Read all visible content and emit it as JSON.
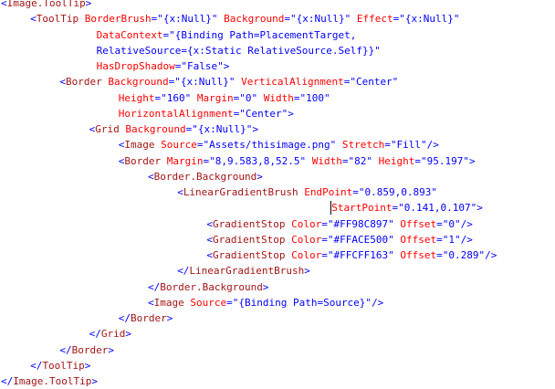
{
  "colors": {
    "punct": "#0000ff",
    "element": "#a31515",
    "attribute": "#ff0000",
    "value": "#0000ff",
    "background": "#ffffff"
  },
  "lines": [
    {
      "indent": 0,
      "tokens": [
        {
          "t": "<",
          "k": "punct"
        },
        {
          "t": "Image.ToolTip",
          "k": "element"
        },
        {
          "t": ">",
          "k": "punct"
        }
      ]
    },
    {
      "indent": 4,
      "tokens": [
        {
          "t": "<",
          "k": "punct"
        },
        {
          "t": "ToolTip",
          "k": "element"
        },
        {
          "t": " BorderBrush",
          "k": "attribute"
        },
        {
          "t": "=\"{x:Null}\"",
          "k": "value"
        },
        {
          "t": " Background",
          "k": "attribute"
        },
        {
          "t": "=\"{x:Null}\"",
          "k": "value"
        },
        {
          "t": " Effect",
          "k": "attribute"
        },
        {
          "t": "=\"{x:Null}\"",
          "k": "value"
        }
      ]
    },
    {
      "indent": 13,
      "tokens": [
        {
          "t": "DataContext",
          "k": "attribute"
        },
        {
          "t": "=\"{Binding Path=PlacementTarget,",
          "k": "value"
        }
      ]
    },
    {
      "indent": 13,
      "tokens": [
        {
          "t": "RelativeSource={x:Static RelativeSource.Self}}\"",
          "k": "value"
        }
      ]
    },
    {
      "indent": 13,
      "tokens": [
        {
          "t": "HasDropShadow",
          "k": "attribute"
        },
        {
          "t": "=\"False\"",
          "k": "value"
        },
        {
          "t": ">",
          "k": "punct"
        }
      ]
    },
    {
      "indent": 8,
      "tokens": [
        {
          "t": "<",
          "k": "punct"
        },
        {
          "t": "Border",
          "k": "element"
        },
        {
          "t": " Background",
          "k": "attribute"
        },
        {
          "t": "=\"{x:Null}\"",
          "k": "value"
        },
        {
          "t": " VerticalAlignment",
          "k": "attribute"
        },
        {
          "t": "=\"Center\"",
          "k": "value"
        }
      ]
    },
    {
      "indent": 16,
      "tokens": [
        {
          "t": "Height",
          "k": "attribute"
        },
        {
          "t": "=\"160\"",
          "k": "value"
        },
        {
          "t": " Margin",
          "k": "attribute"
        },
        {
          "t": "=\"0\"",
          "k": "value"
        },
        {
          "t": " Width",
          "k": "attribute"
        },
        {
          "t": "=\"100\"",
          "k": "value"
        }
      ]
    },
    {
      "indent": 16,
      "tokens": [
        {
          "t": "HorizontalAlignment",
          "k": "attribute"
        },
        {
          "t": "=\"Center\"",
          "k": "value"
        },
        {
          "t": ">",
          "k": "punct"
        }
      ]
    },
    {
      "indent": 12,
      "tokens": [
        {
          "t": "<",
          "k": "punct"
        },
        {
          "t": "Grid",
          "k": "element"
        },
        {
          "t": " Background",
          "k": "attribute"
        },
        {
          "t": "=\"{x:Null}\"",
          "k": "value"
        },
        {
          "t": ">",
          "k": "punct"
        }
      ]
    },
    {
      "indent": 16,
      "tokens": [
        {
          "t": "<",
          "k": "punct"
        },
        {
          "t": "Image",
          "k": "element"
        },
        {
          "t": " Source",
          "k": "attribute"
        },
        {
          "t": "=\"Assets/thisimage.png\"",
          "k": "value"
        },
        {
          "t": " Stretch",
          "k": "attribute"
        },
        {
          "t": "=\"Fill\"",
          "k": "value"
        },
        {
          "t": "/>",
          "k": "punct"
        }
      ]
    },
    {
      "indent": 16,
      "tokens": [
        {
          "t": "<",
          "k": "punct"
        },
        {
          "t": "Border",
          "k": "element"
        },
        {
          "t": " Margin",
          "k": "attribute"
        },
        {
          "t": "=\"8,9.583,8,52.5\"",
          "k": "value"
        },
        {
          "t": " Width",
          "k": "attribute"
        },
        {
          "t": "=\"82\"",
          "k": "value"
        },
        {
          "t": " Height",
          "k": "attribute"
        },
        {
          "t": "=\"95.197\"",
          "k": "value"
        },
        {
          "t": ">",
          "k": "punct"
        }
      ]
    },
    {
      "indent": 20,
      "tokens": [
        {
          "t": "<",
          "k": "punct"
        },
        {
          "t": "Border.Background",
          "k": "element"
        },
        {
          "t": ">",
          "k": "punct"
        }
      ]
    },
    {
      "indent": 24,
      "tokens": [
        {
          "t": "<",
          "k": "punct"
        },
        {
          "t": "LinearGradientBrush",
          "k": "element"
        },
        {
          "t": " EndPoint",
          "k": "attribute"
        },
        {
          "t": "=\"0.859,0.893\"",
          "k": "value"
        }
      ]
    },
    {
      "indent": 45,
      "tokens": [
        {
          "t": "StartPoint",
          "k": "attribute"
        },
        {
          "t": "=\"0.141,0.107\"",
          "k": "value"
        },
        {
          "t": ">",
          "k": "punct"
        }
      ]
    },
    {
      "indent": 28,
      "tokens": [
        {
          "t": "<",
          "k": "punct"
        },
        {
          "t": "GradientStop",
          "k": "element"
        },
        {
          "t": " Color",
          "k": "attribute"
        },
        {
          "t": "=\"#FF98C897\"",
          "k": "value"
        },
        {
          "t": " Offset",
          "k": "attribute"
        },
        {
          "t": "=\"0\"",
          "k": "value"
        },
        {
          "t": "/>",
          "k": "punct"
        }
      ]
    },
    {
      "indent": 28,
      "tokens": [
        {
          "t": "<",
          "k": "punct"
        },
        {
          "t": "GradientStop",
          "k": "element"
        },
        {
          "t": " Color",
          "k": "attribute"
        },
        {
          "t": "=\"#FFACE500\"",
          "k": "value"
        },
        {
          "t": " Offset",
          "k": "attribute"
        },
        {
          "t": "=\"1\"",
          "k": "value"
        },
        {
          "t": "/>",
          "k": "punct"
        }
      ]
    },
    {
      "indent": 28,
      "tokens": [
        {
          "t": "<",
          "k": "punct"
        },
        {
          "t": "GradientStop",
          "k": "element"
        },
        {
          "t": " Color",
          "k": "attribute"
        },
        {
          "t": "=\"#FFCFF163\"",
          "k": "value"
        },
        {
          "t": " Offset",
          "k": "attribute"
        },
        {
          "t": "=\"0.289\"",
          "k": "value"
        },
        {
          "t": "/>",
          "k": "punct"
        }
      ]
    },
    {
      "indent": 24,
      "tokens": [
        {
          "t": "</",
          "k": "punct"
        },
        {
          "t": "LinearGradientBrush",
          "k": "element"
        },
        {
          "t": ">",
          "k": "punct"
        }
      ]
    },
    {
      "indent": 20,
      "tokens": [
        {
          "t": "</",
          "k": "punct"
        },
        {
          "t": "Border.Background",
          "k": "element"
        },
        {
          "t": ">",
          "k": "punct"
        }
      ]
    },
    {
      "indent": 20,
      "tokens": [
        {
          "t": "<",
          "k": "punct"
        },
        {
          "t": "Image",
          "k": "element"
        },
        {
          "t": " Source",
          "k": "attribute"
        },
        {
          "t": "=\"{Binding Path=Source}\"",
          "k": "value"
        },
        {
          "t": "/>",
          "k": "punct"
        }
      ]
    },
    {
      "indent": 16,
      "tokens": [
        {
          "t": "</",
          "k": "punct"
        },
        {
          "t": "Border",
          "k": "element"
        },
        {
          "t": ">",
          "k": "punct"
        }
      ]
    },
    {
      "indent": 12,
      "tokens": [
        {
          "t": "</",
          "k": "punct"
        },
        {
          "t": "Grid",
          "k": "element"
        },
        {
          "t": ">",
          "k": "punct"
        }
      ]
    },
    {
      "indent": 8,
      "tokens": [
        {
          "t": "</",
          "k": "punct"
        },
        {
          "t": "Border",
          "k": "element"
        },
        {
          "t": ">",
          "k": "punct"
        }
      ]
    },
    {
      "indent": 4,
      "tokens": [
        {
          "t": "</",
          "k": "punct"
        },
        {
          "t": "ToolTip",
          "k": "element"
        },
        {
          "t": ">",
          "k": "punct"
        }
      ]
    },
    {
      "indent": 0,
      "tokens": [
        {
          "t": "</",
          "k": "punct"
        },
        {
          "t": "Image.ToolTip",
          "k": "element"
        },
        {
          "t": ">",
          "k": "punct"
        }
      ]
    }
  ],
  "cursor": {
    "line": 13,
    "column": 45
  }
}
